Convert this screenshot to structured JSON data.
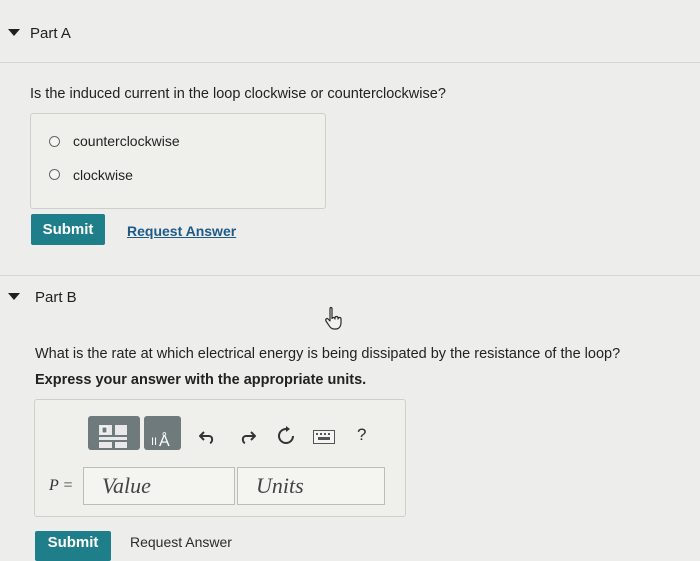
{
  "partA": {
    "title": "Part A",
    "question": "Is the induced current in the loop clockwise or counterclockwise?",
    "options": [
      "counterclockwise",
      "clockwise"
    ],
    "submit_label": "Submit",
    "request_label": "Request Answer"
  },
  "partB": {
    "title": "Part B",
    "question": "What is the rate at which electrical energy is being dissipated by the resistance of the loop?",
    "instruction": "Express your answer with the appropriate units.",
    "variable_label": "P =",
    "value_placeholder": "Value",
    "units_placeholder": "Units",
    "help_label": "?",
    "submit_label": "Submit",
    "request_label": "Request Answer"
  },
  "icons": [
    "caret-down-icon",
    "templates-icon",
    "units-icon",
    "undo-icon",
    "redo-icon",
    "reset-icon",
    "keyboard-icon",
    "help-icon",
    "hand-cursor-icon"
  ]
}
